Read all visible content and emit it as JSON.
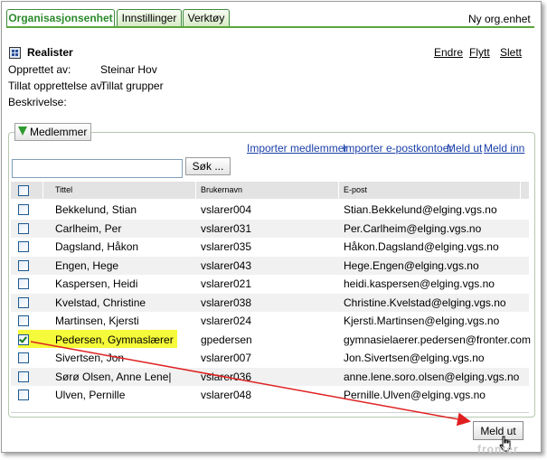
{
  "tabs": [
    {
      "label": "Organisasjonsenhet",
      "active": true
    },
    {
      "label": "Innstillinger",
      "active": false
    },
    {
      "label": "Verktøy",
      "active": false
    }
  ],
  "new_org_label": "Ny org.enhet",
  "unit": {
    "title": "Realister",
    "icon": "org-unit-icon",
    "actions": [
      "Endre",
      "Flytt",
      "Slett"
    ],
    "fields": [
      {
        "label": "Opprettet av:",
        "value": "Steinar Hov"
      },
      {
        "label": "Tillat opprettelse av:",
        "value": "Tillat grupper"
      },
      {
        "label": "Beskrivelse:",
        "value": ""
      }
    ]
  },
  "members": {
    "button_label": "Medlemmer",
    "links": [
      "Importer medlemmer",
      "Importer e-postkontoer",
      "Meld ut",
      "Meld inn"
    ],
    "search": {
      "value": "",
      "button_label": "Søk ..."
    },
    "columns": [
      "Tittel",
      "Brukernavn",
      "E-post"
    ],
    "rows": [
      {
        "name": "Bekkelund, Stian",
        "username": "vslarer004",
        "email": "Stian.Bekkelund@elging.vgs.no",
        "checked": false
      },
      {
        "name": "Carlheim, Per",
        "username": "vslarer031",
        "email": "Per.Carlheim@elging.vgs.no",
        "checked": false
      },
      {
        "name": "Dagsland, Håkon",
        "username": "vslarer035",
        "email": "Håkon.Dagsland@elging.vgs.no",
        "checked": false
      },
      {
        "name": "Engen, Hege",
        "username": "vslarer043",
        "email": "Hege.Engen@elging.vgs.no",
        "checked": false
      },
      {
        "name": "Kaspersen, Heidi",
        "username": "vslarer021",
        "email": "heidi.kaspersen@elging.vgs.no",
        "checked": false
      },
      {
        "name": "Kvelstad, Christine",
        "username": "vslarer038",
        "email": "Christine.Kvelstad@elging.vgs.no",
        "checked": false
      },
      {
        "name": "Martinsen, Kjersti",
        "username": "vslarer024",
        "email": "Kjersti.Martinsen@elging.vgs.no",
        "checked": false
      },
      {
        "name": "Pedersen, Gymnaslærer",
        "username": "gpedersen",
        "email": "gymnasielaerer.pedersen@fronter.com",
        "checked": true
      },
      {
        "name": "Sivertsen, Jon",
        "username": "vslarer007",
        "email": "Jon.Sivertsen@elging.vgs.no",
        "checked": false
      },
      {
        "name": "Sørø Olsen, Anne Lene|",
        "username": "vslarer036",
        "email": "anne.lene.soro.olsen@elging.vgs.no",
        "checked": false
      },
      {
        "name": "Ulven, Pernille",
        "username": "vslarer048",
        "email": "Pernille.Ulven@elging.vgs.no",
        "checked": false
      }
    ],
    "leave_button_label": "Meld ut"
  },
  "watermark": "fronter",
  "colors": {
    "accent_green": "#2a8a2a",
    "link_blue": "#1a3fa8",
    "highlight": "#f5fa3a",
    "arrow_red": "#e02020"
  }
}
